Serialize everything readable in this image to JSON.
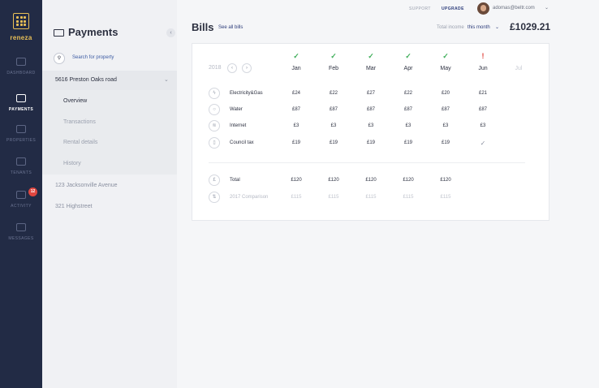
{
  "app": {
    "logo_text": "reneza"
  },
  "nav": [
    {
      "id": "dashboard",
      "label": "DASHBOARD",
      "icon": "dashboard-icon"
    },
    {
      "id": "payments",
      "label": "PAYMENTS",
      "icon": "wallet-icon",
      "active": true
    },
    {
      "id": "properties",
      "label": "PROPERTIES",
      "icon": "house-icon"
    },
    {
      "id": "tenants",
      "label": "TENANTS",
      "icon": "people-icon"
    },
    {
      "id": "activity",
      "label": "ACTIVITY",
      "icon": "bell-icon",
      "badge": "12"
    },
    {
      "id": "messages",
      "label": "MESSAGES",
      "icon": "envelope-icon"
    }
  ],
  "panel": {
    "title": "Payments",
    "collapse_glyph": "‹",
    "search_label": "Search for property",
    "active_property": "5616 Preston Oaks road",
    "sub_items": [
      "Overview",
      "Transactions",
      "Rental details",
      "History"
    ],
    "other_properties": [
      "123 Jacksonville Avenue",
      "321 Highstreet"
    ]
  },
  "topbar": {
    "support": "SUPPORT",
    "upgrade": "UPGRADE",
    "user_email": "adomas@beltr.com"
  },
  "bills": {
    "title": "Bills",
    "see_all": "See all bills",
    "income_label": "Total income",
    "income_period": "this month",
    "income_total": "£1029.21",
    "year": "2018",
    "months": [
      "Jan",
      "Feb",
      "Mar",
      "Apr",
      "May",
      "Jun",
      "Jul"
    ],
    "month_status": [
      "ok",
      "ok",
      "ok",
      "ok",
      "ok",
      "warn",
      "none"
    ],
    "rows": [
      {
        "label": "Electricity&Gas",
        "icon": "lightning-icon",
        "values": [
          "£24",
          "£22",
          "£27",
          "£22",
          "£20",
          "£21"
        ]
      },
      {
        "label": "Water",
        "icon": "droplet-icon",
        "values": [
          "£87",
          "£87",
          "£87",
          "£87",
          "£87",
          "£87"
        ]
      },
      {
        "label": "Internet",
        "icon": "wifi-icon",
        "values": [
          "£3",
          "£3",
          "£3",
          "£3",
          "£3",
          "£3"
        ]
      },
      {
        "label": "Council tax",
        "icon": "document-icon",
        "values": [
          "£19",
          "£19",
          "£19",
          "£19",
          "£19",
          "✓"
        ]
      }
    ],
    "total": {
      "label": "Total",
      "icon": "pound-icon",
      "values": [
        "£120",
        "£120",
        "£120",
        "£120",
        "£120"
      ]
    },
    "comparison": {
      "label": "2017 Comparison",
      "icon": "swap-icon",
      "values": [
        "£115",
        "£115",
        "£115",
        "£115",
        "£115"
      ]
    }
  },
  "colors": {
    "rail": "#222b45",
    "accent": "#e8bf57",
    "link": "#2c3c7a",
    "ok": "#3fae5a",
    "warn": "#e0463f"
  }
}
